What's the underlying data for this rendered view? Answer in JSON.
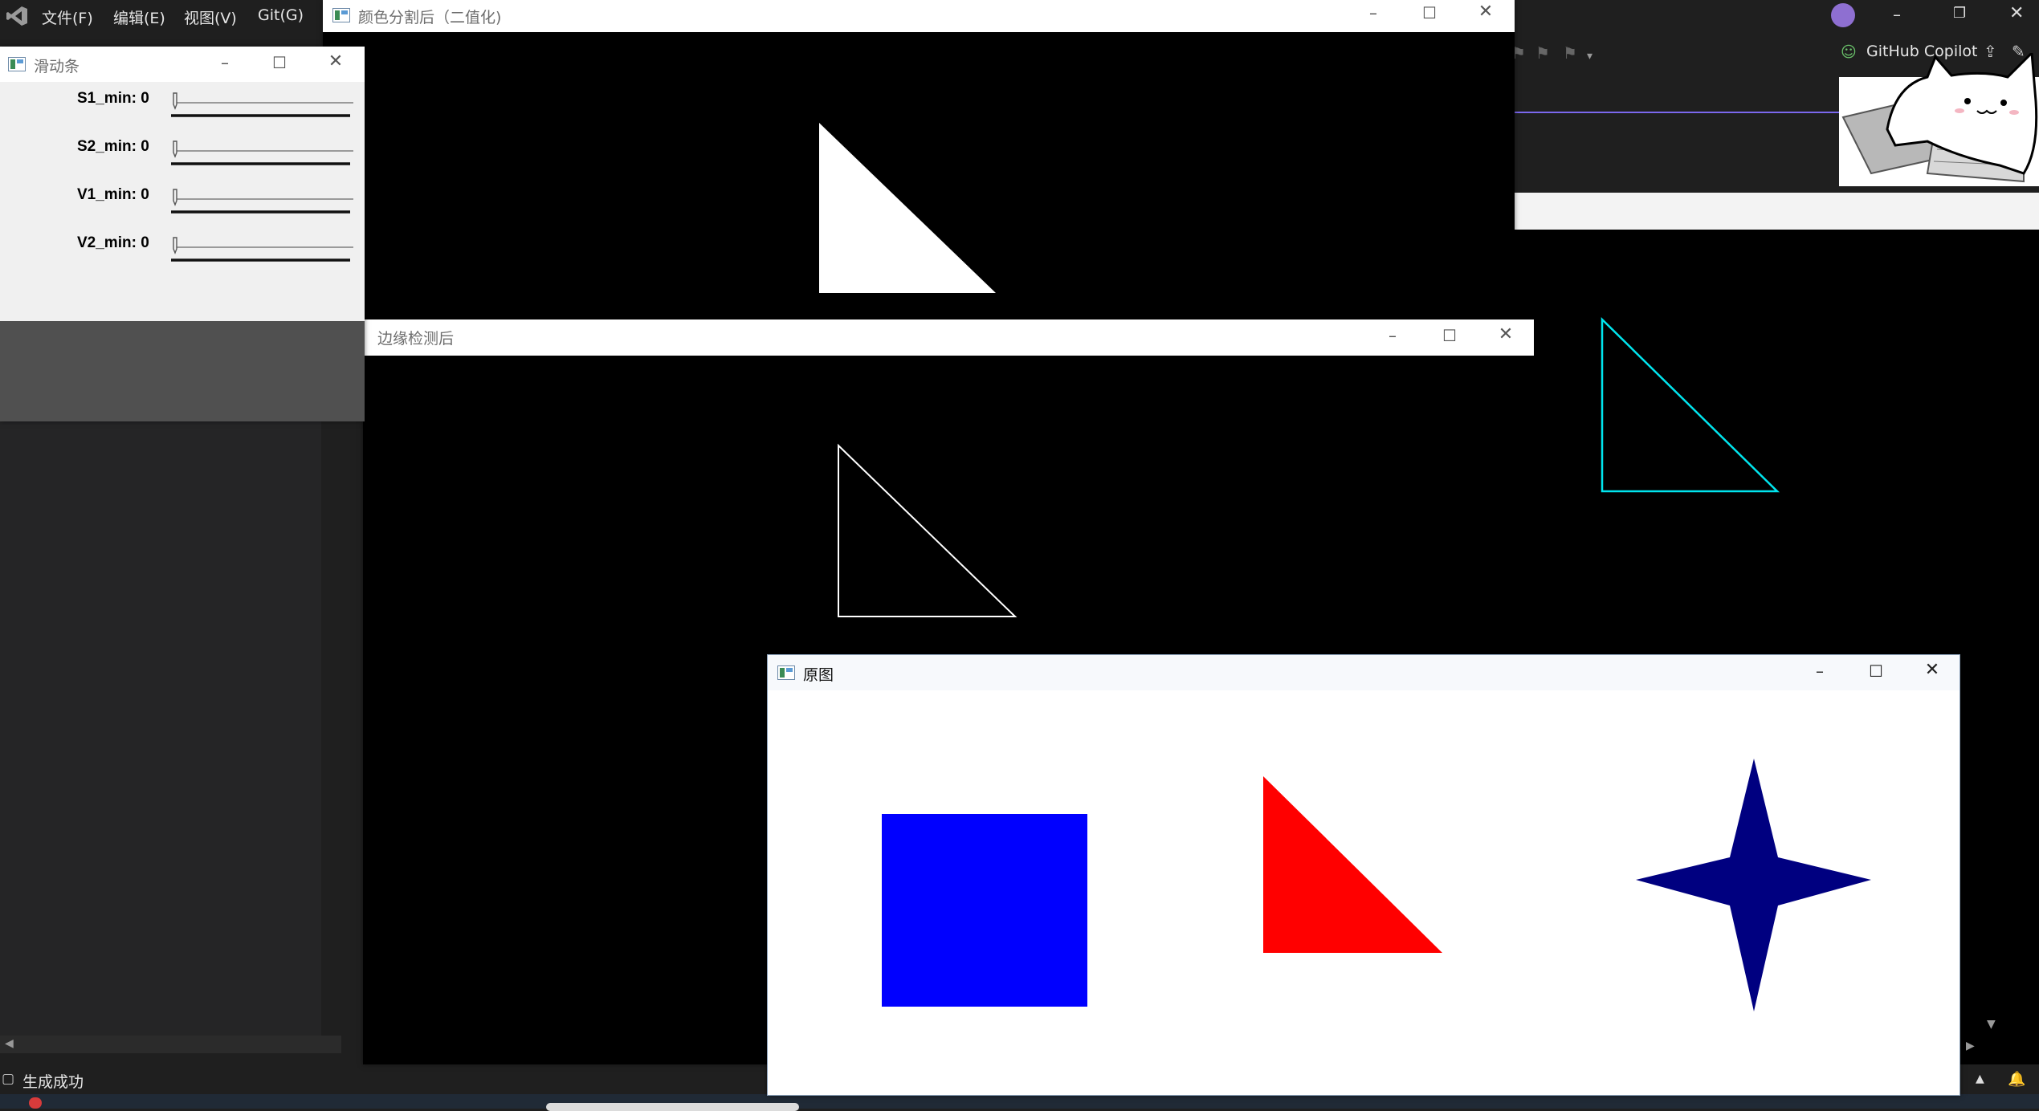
{
  "ide": {
    "menu": [
      "文件(F)",
      "编辑(E)",
      "视图(V)",
      "Git(G)"
    ],
    "copilot_label": "GitHub Copilot",
    "status_text": "生成成功"
  },
  "windows": {
    "binary": {
      "title": "颜色分割后（二值化)"
    },
    "edge": {
      "title": "边缘检测后"
    },
    "trackbar": {
      "title": "滑动条",
      "sliders": [
        {
          "label": "S1_min: 0",
          "value": 0
        },
        {
          "label": "S2_min: 0",
          "value": 0
        },
        {
          "label": "V1_min: 0",
          "value": 0
        },
        {
          "label": "V2_min: 0",
          "value": 0
        }
      ]
    },
    "original": {
      "title": "原图"
    }
  },
  "shapes": {
    "square_color": "#0000ff",
    "triangle_color": "#ff0000",
    "star_color": "#000080",
    "contour_color": "#00e5ee"
  },
  "icons": {
    "min": "minimize-icon",
    "max": "maximize-icon",
    "close": "close-icon"
  }
}
